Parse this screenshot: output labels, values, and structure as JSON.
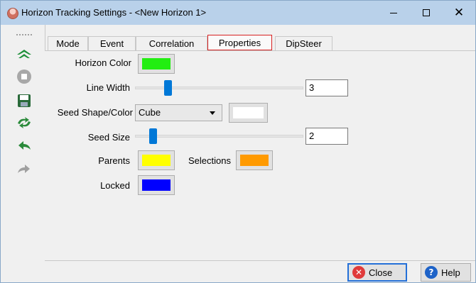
{
  "window": {
    "title": "Horizon Tracking Settings - <New Horizon 1>"
  },
  "toolbar": {
    "icons": [
      "track-horizon-icon",
      "stop-icon",
      "save-icon",
      "retrack-icon",
      "undo-icon",
      "redo-icon"
    ]
  },
  "tabs": [
    {
      "label": "Mode"
    },
    {
      "label": "Event"
    },
    {
      "label": "Correlation"
    },
    {
      "label": "Properties",
      "active": true
    },
    {
      "label": "DipSteer"
    }
  ],
  "properties": {
    "horizon_color_label": "Horizon Color",
    "horizon_color": "#22ee11",
    "line_width_label": "Line Width",
    "line_width_value": "3",
    "line_width_slider": 0.18,
    "seed_shape_label": "Seed Shape/Color",
    "seed_shape_value": "Cube",
    "seed_color": "#ffffff",
    "seed_size_label": "Seed Size",
    "seed_size_value": "2",
    "seed_size_slider": 0.09,
    "parents_label": "Parents",
    "parents_color": "#ffff00",
    "selections_label": "Selections",
    "selections_color": "#ff9a00",
    "locked_label": "Locked",
    "locked_color": "#0000ff"
  },
  "buttons": {
    "close_label": "Close",
    "help_label": "Help"
  }
}
